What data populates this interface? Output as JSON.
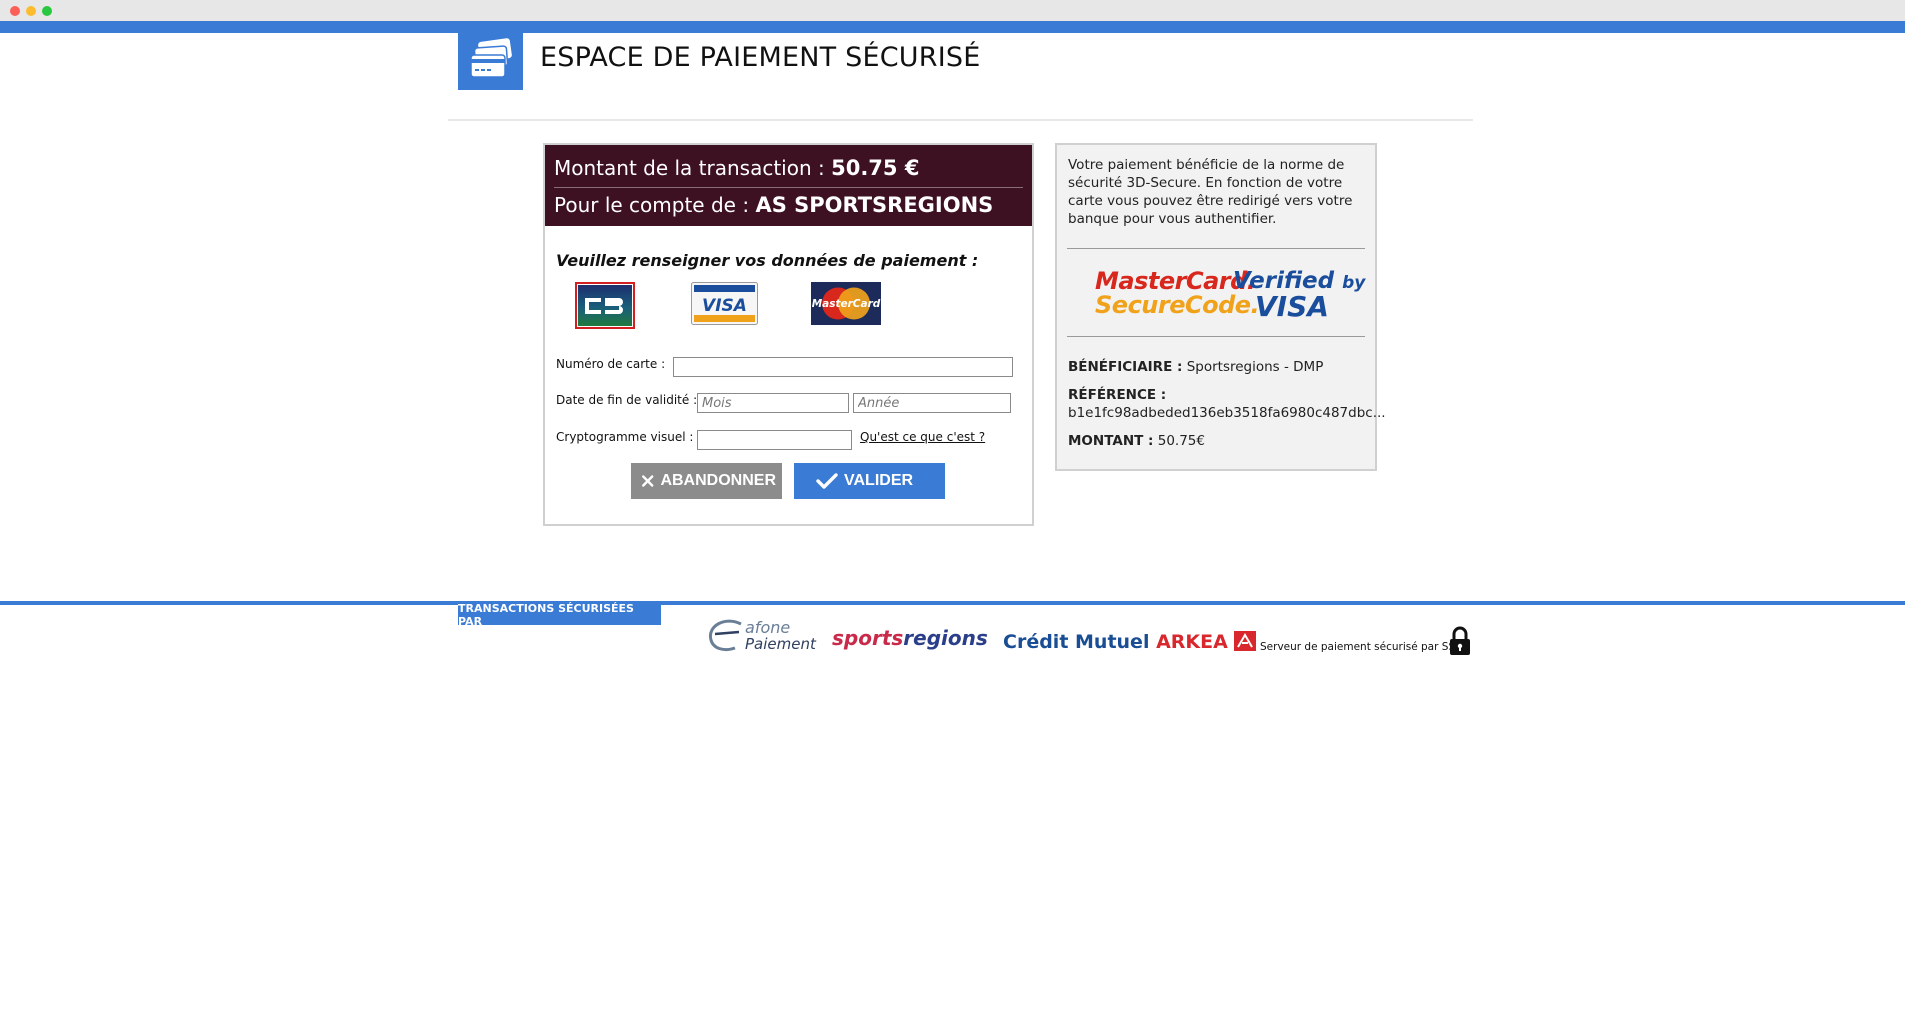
{
  "header": {
    "title": "ESPACE DE PAIEMENT SÉCURISÉ"
  },
  "transaction": {
    "amount_label": "Montant de la transaction : ",
    "amount_value": "50.75 €",
    "account_label": "Pour le compte de : ",
    "account_value": "AS SPORTSREGIONS"
  },
  "form": {
    "instructions": "Veuillez renseigner vos données de paiement :",
    "card_types": [
      {
        "name": "CB",
        "selected": true
      },
      {
        "name": "VISA",
        "selected": false
      },
      {
        "name": "MasterCard",
        "selected": false
      }
    ],
    "card_number_label": "Numéro de carte :",
    "card_number_value": "",
    "expiry_label": "Date de fin de validité :",
    "month_placeholder": "Mois",
    "year_placeholder": "Année",
    "cvv_label": "Cryptogramme visuel :",
    "cvv_value": "",
    "cvv_help_link": "Qu'est ce que c'est ?",
    "cancel_label": "ABANDONNER",
    "submit_label": "VALIDER"
  },
  "info": {
    "security_text": "Votre paiement bénéficie de la norme de sécurité 3D-Secure. En fonction de votre carte vous pouvez être redirigé vers votre banque pour vous authentifier.",
    "securecode_line1": "MasterCard.",
    "securecode_line2": "SecureCode.",
    "verified_line1": "Verified",
    "verified_by": "by",
    "verified_line2": "VISA",
    "beneficiary_label": "BÉNÉFICIAIRE :",
    "beneficiary_value": "Sportsregions - DMP",
    "reference_label": "RÉFÉRENCE :",
    "reference_value": "b1e1fc98adbeded136eb3518fa6980c487dbc...",
    "amount_label": "MONTANT :",
    "amount_value": "50.75€"
  },
  "footer": {
    "secured_by": "TRANSACTIONS SÉCURISÉES PAR",
    "afone_line1": "afone",
    "afone_line2": "Paiement",
    "sportsregions_a": "sports",
    "sportsregions_b": "regions",
    "cm_name": "Crédit Mutuel ",
    "cm_arkea": "ARKEA",
    "ssl_text": "Serveur de paiement sécurisé par SSL"
  },
  "colors": {
    "brand_blue": "#3a7bd5",
    "header_bg": "#3d1022",
    "cancel_gray": "#8c8c8c"
  }
}
